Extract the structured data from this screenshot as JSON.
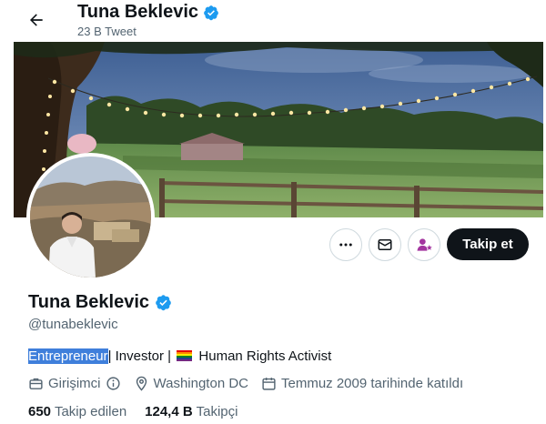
{
  "header": {
    "title": "Tuna Beklevic",
    "subtitle": "23 B Tweet"
  },
  "profile": {
    "name": "Tuna Beklevic",
    "handle": "@tunabeklevic",
    "bio": {
      "selected": "Entrepreneur",
      "part1": "| Investor |",
      "part2": "Human Rights Activist"
    },
    "meta": {
      "category": "Girişimci",
      "location": "Washington DC",
      "joined": "Temmuz 2009 tarihinde katıldı"
    },
    "stats": {
      "following_count": "650",
      "following_label": "Takip edilen",
      "followers_count": "124,4 B",
      "followers_label": "Takipçi"
    }
  },
  "actions": {
    "follow_label": "Takip et"
  },
  "icons": [
    "back-arrow-icon",
    "verified-badge-icon",
    "more-icon",
    "message-icon",
    "subscribe-icon",
    "briefcase-icon",
    "info-icon",
    "location-pin-icon",
    "calendar-icon",
    "rainbow-flag-icon"
  ],
  "colors": {
    "verified": "#1d9bf0",
    "follow_button": "#0f1419",
    "subtle_text": "#536471",
    "selection": "#3f7fdb",
    "subscribe_icon": "#a3359f"
  }
}
